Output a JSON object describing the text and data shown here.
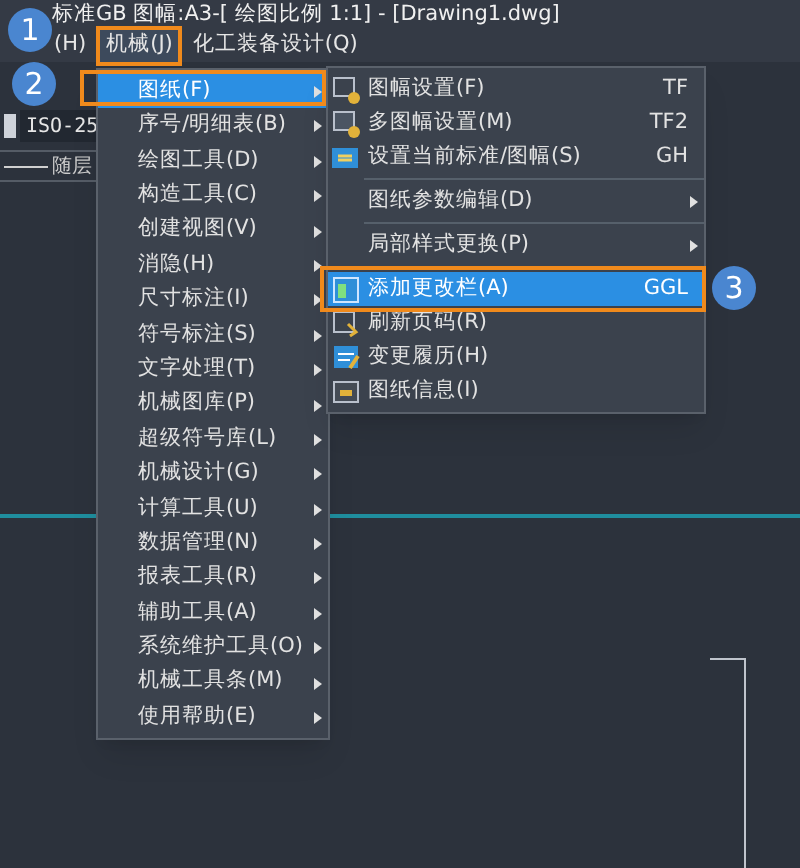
{
  "window": {
    "title": "标准GB 图幅:A3-[ 绘图比例 1:1] - [Drawing1.dwg]"
  },
  "menubar": [
    {
      "label": "(H)",
      "selected": false
    },
    {
      "label": "机械(J)",
      "selected": true
    },
    {
      "label": "化工装备设计(Q)",
      "selected": false
    }
  ],
  "toolbar": {
    "dimension_style": "ISO-25",
    "layer": "随层"
  },
  "menu": [
    {
      "label": "图纸(F)",
      "selected": true
    },
    {
      "label": "序号/明细表(B)",
      "selected": false
    },
    {
      "label": "绘图工具(D)",
      "selected": false
    },
    {
      "label": "构造工具(C)",
      "selected": false
    },
    {
      "label": "创建视图(V)",
      "selected": false
    },
    {
      "label": "消隐(H)",
      "selected": false
    },
    {
      "label": "尺寸标注(I)",
      "selected": false
    },
    {
      "label": "符号标注(S)",
      "selected": false
    },
    {
      "label": "文字处理(T)",
      "selected": false
    },
    {
      "label": "机械图库(P)",
      "selected": false
    },
    {
      "label": "超级符号库(L)",
      "selected": false
    },
    {
      "label": "机械设计(G)",
      "selected": false
    },
    {
      "label": "计算工具(U)",
      "selected": false
    },
    {
      "label": "数据管理(N)",
      "selected": false
    },
    {
      "label": "报表工具(R)",
      "selected": false
    },
    {
      "label": "辅助工具(A)",
      "selected": false
    },
    {
      "label": "系统维护工具(O)",
      "selected": false
    },
    {
      "label": "机械工具条(M)",
      "selected": false
    },
    {
      "label": "使用帮助(E)",
      "selected": false
    }
  ],
  "submenu": [
    {
      "kind": "item",
      "label": "图幅设置(F)",
      "shortcut": "TF",
      "selected": false
    },
    {
      "kind": "item",
      "label": "多图幅设置(M)",
      "shortcut": "TF2",
      "selected": false
    },
    {
      "kind": "item",
      "label": "设置当前标准/图幅(S)",
      "shortcut": "GH",
      "selected": false
    },
    {
      "kind": "separator"
    },
    {
      "kind": "submenu",
      "label": "图纸参数编辑(D)",
      "selected": false
    },
    {
      "kind": "separator"
    },
    {
      "kind": "submenu",
      "label": "局部样式更换(P)",
      "selected": false
    },
    {
      "kind": "separator"
    },
    {
      "kind": "item",
      "label": "添加更改栏(A)",
      "shortcut": "GGL",
      "selected": true
    },
    {
      "kind": "item",
      "label": "刷新页码(R)",
      "selected": false
    },
    {
      "kind": "item",
      "label": "变更履历(H)",
      "selected": false
    },
    {
      "kind": "item",
      "label": "图纸信息(I)",
      "selected": false
    }
  ],
  "callouts": [
    "1",
    "2",
    "3"
  ]
}
